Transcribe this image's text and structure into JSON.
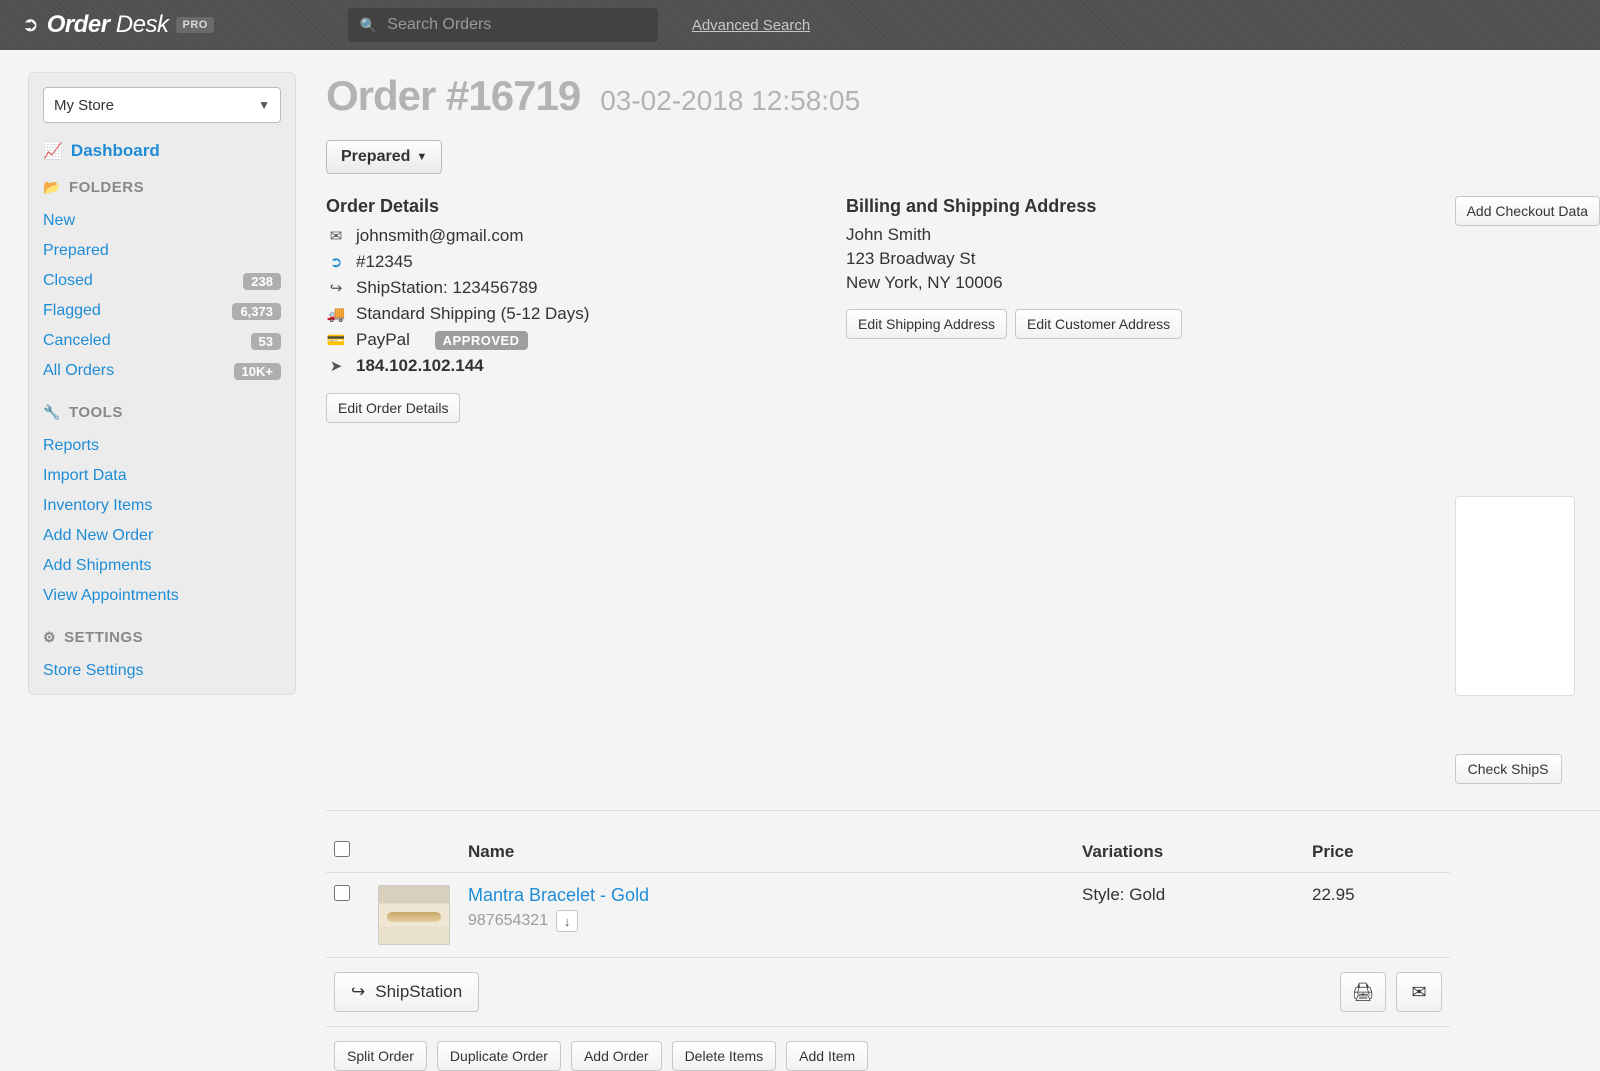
{
  "header": {
    "brand_a": "Order",
    "brand_b": "Desk",
    "pro": "PRO",
    "search_placeholder": "Search Orders",
    "advanced_search": "Advanced Search"
  },
  "sidebar": {
    "store": "My Store",
    "dashboard": "Dashboard",
    "folders_heading": "FOLDERS",
    "tools_heading": "TOOLS",
    "settings_heading": "SETTINGS",
    "folders": [
      {
        "label": "New",
        "badge": ""
      },
      {
        "label": "Prepared",
        "badge": ""
      },
      {
        "label": "Closed",
        "badge": "238"
      },
      {
        "label": "Flagged",
        "badge": "6,373"
      },
      {
        "label": "Canceled",
        "badge": "53"
      },
      {
        "label": "All Orders",
        "badge": "10K+"
      }
    ],
    "tools": [
      {
        "label": "Reports"
      },
      {
        "label": "Import Data"
      },
      {
        "label": "Inventory Items"
      },
      {
        "label": "Add New Order"
      },
      {
        "label": "Add Shipments"
      },
      {
        "label": "View Appointments"
      }
    ],
    "settings": [
      {
        "label": "Store Settings"
      }
    ]
  },
  "order": {
    "title": "Order #16719",
    "timestamp": "03-02-2018 12:58:05",
    "status": "Prepared",
    "details_heading": "Order Details",
    "email": "johnsmith@gmail.com",
    "internal_id": "#12345",
    "shipstation": "ShipStation: 123456789",
    "shipping_method": "Standard Shipping (5-12 Days)",
    "payment": "PayPal",
    "payment_status": "APPROVED",
    "ip": "184.102.102.144",
    "edit_details": "Edit Order Details",
    "billing_heading": "Billing and Shipping Address",
    "address": {
      "name": "John Smith",
      "line1": "123 Broadway St",
      "line2": "New York, NY 10006"
    },
    "edit_shipping": "Edit Shipping Address",
    "edit_customer": "Edit Customer Address",
    "add_checkout": "Add Checkout Data"
  },
  "items": {
    "headers": {
      "name": "Name",
      "variations": "Variations",
      "price": "Price"
    },
    "rows": [
      {
        "name": "Mantra Bracelet - Gold",
        "sku": "987654321",
        "variation": "Style: Gold",
        "price": "22.95"
      }
    ]
  },
  "item_actions": {
    "shipstation": "ShipStation"
  },
  "order_actions": {
    "split": "Split Order",
    "duplicate": "Duplicate Order",
    "add_order": "Add Order",
    "delete_items": "Delete Items",
    "add_item": "Add Item",
    "check_ship": "Check ShipS"
  }
}
